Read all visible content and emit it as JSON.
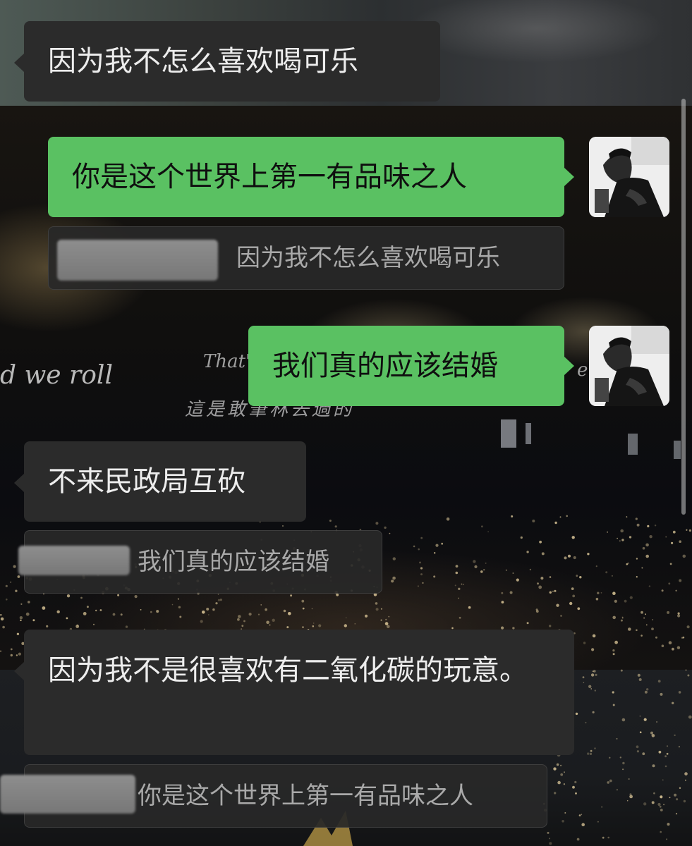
{
  "messages": [
    {
      "type": "incoming",
      "text": "因为我不怎么喜欢喝可乐"
    },
    {
      "type": "outgoing",
      "text": "你是这个世界上第一有品味之人",
      "quote": "因为我不怎么喜欢喝可乐"
    },
    {
      "type": "outgoing",
      "text": "我们真的应该结婚"
    },
    {
      "type": "incoming",
      "text": "不来民政局互砍",
      "quote": "我们真的应该结婚"
    },
    {
      "type": "incoming",
      "text": "因为我不是很喜欢有二氧化碳的玩意。",
      "quote": "你是这个世界上第一有品味之人"
    }
  ],
  "background_text": {
    "left_line": "d we roll",
    "middle_line": "That'",
    "chinese_line": "這是敢筆林去過的",
    "right_line": "e roll"
  },
  "colors": {
    "incoming_bubble": "#2b2b2b",
    "outgoing_bubble": "#5ac162",
    "quote_text": "#a9a9a9"
  },
  "icons": {
    "avatar": "user-avatar-photo",
    "redaction": "blurred-name"
  }
}
